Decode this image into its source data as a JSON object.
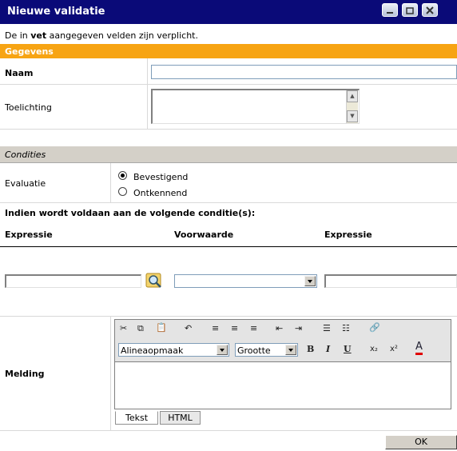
{
  "window": {
    "title": "Nieuwe validatie"
  },
  "intro": {
    "before": "De in ",
    "bold": "vet",
    "after": " aangegeven velden zijn verplicht."
  },
  "sections": {
    "gegevens": "Gegevens",
    "condities": "Condities"
  },
  "fields": {
    "naam": "Naam",
    "toelichting": "Toelichting",
    "evaluatie": "Evaluatie",
    "melding": "Melding"
  },
  "evaluatie": {
    "options": [
      "Bevestigend",
      "Ontkennend"
    ],
    "selected": "Bevestigend"
  },
  "conditie": {
    "heading": "Indien wordt voldaan aan de volgende conditie(s):",
    "columns": [
      "Expressie",
      "Voorwaarde",
      "Expressie"
    ]
  },
  "editor": {
    "paragraph_format": "Alineaopmaak",
    "font_size": "Grootte",
    "tabs": [
      "Tekst",
      "HTML"
    ],
    "active_tab": "Tekst",
    "icons": [
      "cut-icon",
      "copy-icon",
      "paste-icon",
      "undo-icon",
      "align-left-icon",
      "align-center-icon",
      "align-right-icon",
      "outdent-icon",
      "indent-icon",
      "bullet-list-icon",
      "number-list-icon",
      "link-icon",
      "bold-icon",
      "italic-icon",
      "underline-icon",
      "subscript-icon",
      "superscript-icon",
      "font-color-icon"
    ],
    "format_letters": {
      "bold": "B",
      "italic": "I",
      "underline": "U",
      "subscript": "x₂",
      "superscript": "x²",
      "color": "A"
    }
  },
  "buttons": {
    "ok": "OK"
  },
  "colors": {
    "titlebar": "#0a0a78",
    "section": "#f7a413",
    "conditie_bar": "#d4d0c8"
  }
}
